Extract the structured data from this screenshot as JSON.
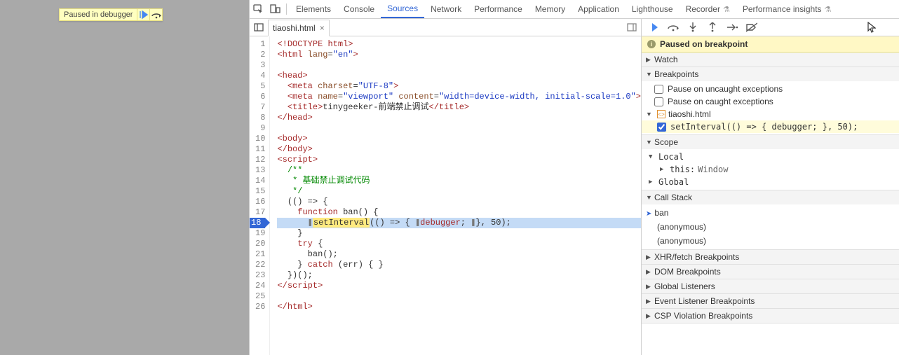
{
  "page": {
    "toast_text": "Paused in debugger"
  },
  "tabs": {
    "list": [
      "Elements",
      "Console",
      "Sources",
      "Network",
      "Performance",
      "Memory",
      "Application",
      "Lighthouse",
      "Recorder",
      "Performance insights"
    ],
    "active_index": 2,
    "flask_indices": [
      8,
      9
    ]
  },
  "file": {
    "name": "tiaoshi.html"
  },
  "code": {
    "exec_line": 18,
    "lines": [
      {
        "n": 1,
        "html": "<span class='tok-tag'>&lt;!DOCTYPE</span> <span class='tok-tag'>html</span><span class='tok-tag'>&gt;</span>"
      },
      {
        "n": 2,
        "html": "<span class='tok-tag'>&lt;html</span> <span class='tok-attr'>lang</span>=<span class='tok-str'>\"en\"</span><span class='tok-tag'>&gt;</span>"
      },
      {
        "n": 3,
        "html": ""
      },
      {
        "n": 4,
        "html": "<span class='tok-tag'>&lt;head&gt;</span>"
      },
      {
        "n": 5,
        "html": "  <span class='tok-tag'>&lt;meta</span> <span class='tok-attr'>charset</span>=<span class='tok-str'>\"UTF-8\"</span><span class='tok-tag'>&gt;</span>"
      },
      {
        "n": 6,
        "html": "  <span class='tok-tag'>&lt;meta</span> <span class='tok-attr'>name</span>=<span class='tok-str'>\"viewport\"</span> <span class='tok-attr'>content</span>=<span class='tok-str'>\"width=device-width, initial-scale=1.0\"</span><span class='tok-tag'>&gt;</span>"
      },
      {
        "n": 7,
        "html": "  <span class='tok-tag'>&lt;title&gt;</span>tinygeeker-前端禁止调试<span class='tok-tag'>&lt;/title&gt;</span>"
      },
      {
        "n": 8,
        "html": "<span class='tok-tag'>&lt;/head&gt;</span>"
      },
      {
        "n": 9,
        "html": ""
      },
      {
        "n": 10,
        "html": "<span class='tok-tag'>&lt;body&gt;</span>"
      },
      {
        "n": 11,
        "html": "<span class='tok-tag'>&lt;/body&gt;</span>"
      },
      {
        "n": 12,
        "html": "<span class='tok-tag'>&lt;script&gt;</span>"
      },
      {
        "n": 13,
        "html": "  <span class='tok-comment'>/**</span>"
      },
      {
        "n": 14,
        "html": "   <span class='tok-comment'>* 基础禁止调试代码</span>"
      },
      {
        "n": 15,
        "html": "   <span class='tok-comment'>*/</span>"
      },
      {
        "n": 16,
        "html": "  (() =&gt; {"
      },
      {
        "n": 17,
        "html": "    <span class='tok-kw'>function</span> ban() {"
      },
      {
        "n": 18,
        "html": "      <span class='cursor-mark'>❚</span><span class='tok-bg1'>setInterval</span>(() =&gt; { <span class='cursor-mark'>❚</span><span class='tok-kw'>debugger</span>; <span class='cursor-mark'>❚</span>}, 50);"
      },
      {
        "n": 19,
        "html": "    }"
      },
      {
        "n": 20,
        "html": "    <span class='tok-kw'>try</span> {"
      },
      {
        "n": 21,
        "html": "      ban();"
      },
      {
        "n": 22,
        "html": "    } <span class='tok-kw'>catch</span> (err) { }"
      },
      {
        "n": 23,
        "html": "  })();"
      },
      {
        "n": 24,
        "html": "<span class='tok-tag'>&lt;/script&gt;</span>"
      },
      {
        "n": 25,
        "html": ""
      },
      {
        "n": 26,
        "html": "<span class='tok-tag'>&lt;/html&gt;</span>"
      }
    ]
  },
  "banner": {
    "text": "Paused on breakpoint"
  },
  "sections": {
    "watch": {
      "title": "Watch"
    },
    "breakpoints": {
      "title": "Breakpoints",
      "opt_uncaught": "Pause on uncaught exceptions",
      "opt_caught": "Pause on caught exceptions",
      "file": "tiaoshi.html",
      "bp_text": "setInterval(() => { debugger; }, 50);"
    },
    "scope": {
      "title": "Scope",
      "local": "Local",
      "this": "this:",
      "this_val": "Window",
      "global": "Global"
    },
    "callstack": {
      "title": "Call Stack",
      "frames": [
        "ban",
        "(anonymous)",
        "(anonymous)"
      ]
    },
    "xhr": {
      "title": "XHR/fetch Breakpoints"
    },
    "dom": {
      "title": "DOM Breakpoints"
    },
    "global_listeners": {
      "title": "Global Listeners"
    },
    "event_listeners": {
      "title": "Event Listener Breakpoints"
    },
    "csp": {
      "title": "CSP Violation Breakpoints"
    }
  }
}
